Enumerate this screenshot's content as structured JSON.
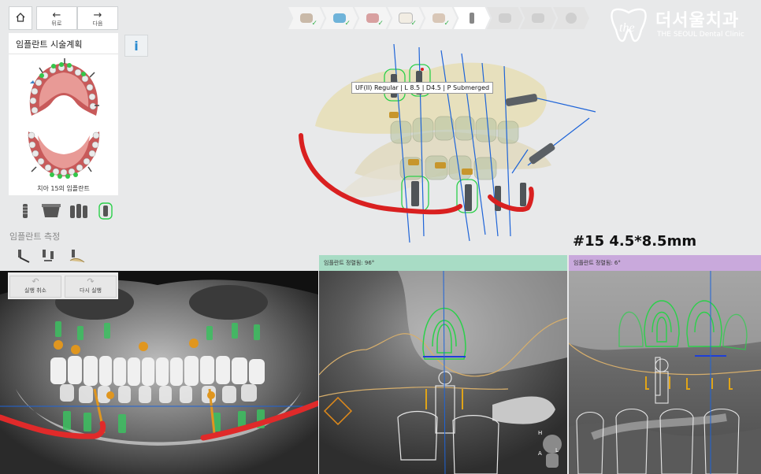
{
  "nav": {
    "back_label": "뒤로",
    "next_label": "다음"
  },
  "steps": [
    {
      "name": "scan-step",
      "state": "done"
    },
    {
      "name": "scan-merge-step",
      "state": "done"
    },
    {
      "name": "tooth-select-step",
      "state": "done"
    },
    {
      "name": "crown-step",
      "state": "done"
    },
    {
      "name": "nerve-step",
      "state": "done"
    },
    {
      "name": "implant-step",
      "state": "active"
    },
    {
      "name": "abutment-step",
      "state": "todo"
    },
    {
      "name": "guide-step",
      "state": "todo"
    },
    {
      "name": "export-step",
      "state": "todo"
    }
  ],
  "logo": {
    "title": "더서울치과",
    "subtitle": "THE SEOUL Dental Clinic"
  },
  "panel": {
    "title": "임플란트 시술계획",
    "info_icon": "i",
    "caption": "치아 15의 임플란트"
  },
  "measure": {
    "label": "임플란트 측정"
  },
  "actions": {
    "undo_label": "실행 취소",
    "redo_label": "다시 실행"
  },
  "viewer3d": {
    "tooltip": "UF(II) Regular | L 8.5 | D4.5 | P Submerged",
    "implant_label": "#15  4.5*8.5mm"
  },
  "views": {
    "pano_label": "",
    "cross_label": "임플란트 정렬됨: 96°",
    "sagittal_label": "임플란트 정렬됨: 6°"
  },
  "colors": {
    "cross_bar": "#a8dcc5",
    "sagittal_bar": "#c9a9dc",
    "nerve": "#d92020",
    "implant_outline": "#2bd04a",
    "axis": "#1e64d8"
  }
}
